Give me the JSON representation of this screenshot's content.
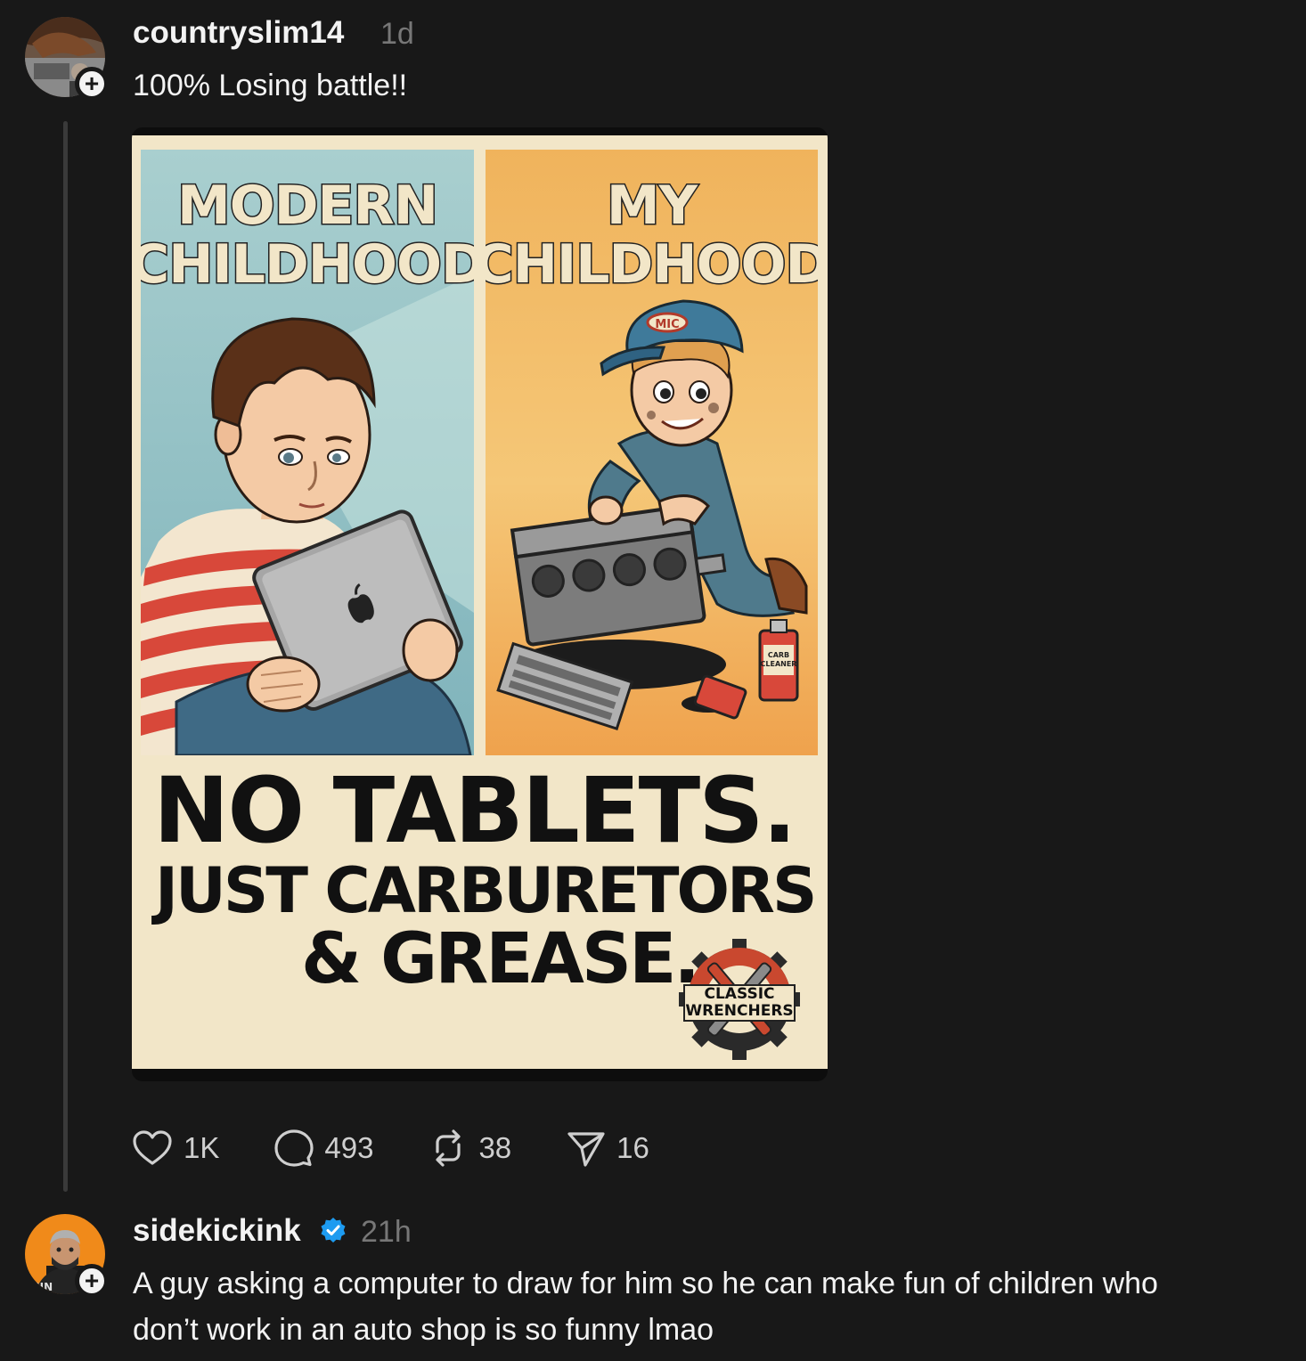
{
  "posts": [
    {
      "username": "countryslim14",
      "time": "1d",
      "text": "100% Losing battle!!",
      "image": {
        "left_title_line1": "MODERN",
        "left_title_line2": "CHILDHOOD",
        "right_title_line1": "MY",
        "right_title_line2": "CHILDHOOD",
        "cap_logo": "MIC",
        "can_label_line1": "CARB",
        "can_label_line2": "CLEANER",
        "headline_line1": "NO TABLETS.",
        "headline_line2": "JUST CARBURETORS",
        "headline_line3": "& GREASE.",
        "badge_line1": "CLASSIC",
        "badge_line2": "WRENCHERS"
      },
      "actions": {
        "likes": "1K",
        "replies": "493",
        "reposts": "38",
        "shares": "16"
      }
    },
    {
      "username": "sidekickink",
      "verified": true,
      "time": "21h",
      "text_line1": "A guy asking a computer to draw for him so he can make fun of children who",
      "text_line2": "don’t work in an auto shop is so funny lmao"
    }
  ],
  "colors": {
    "background": "#181818",
    "text": "#f3f3f3",
    "muted": "#777777",
    "verified": "#1d9bf0"
  },
  "icons": {
    "like": "heart-icon",
    "reply": "comment-icon",
    "repost": "repost-icon",
    "share": "send-icon",
    "follow": "plus-icon",
    "verified": "verified-badge-icon"
  }
}
